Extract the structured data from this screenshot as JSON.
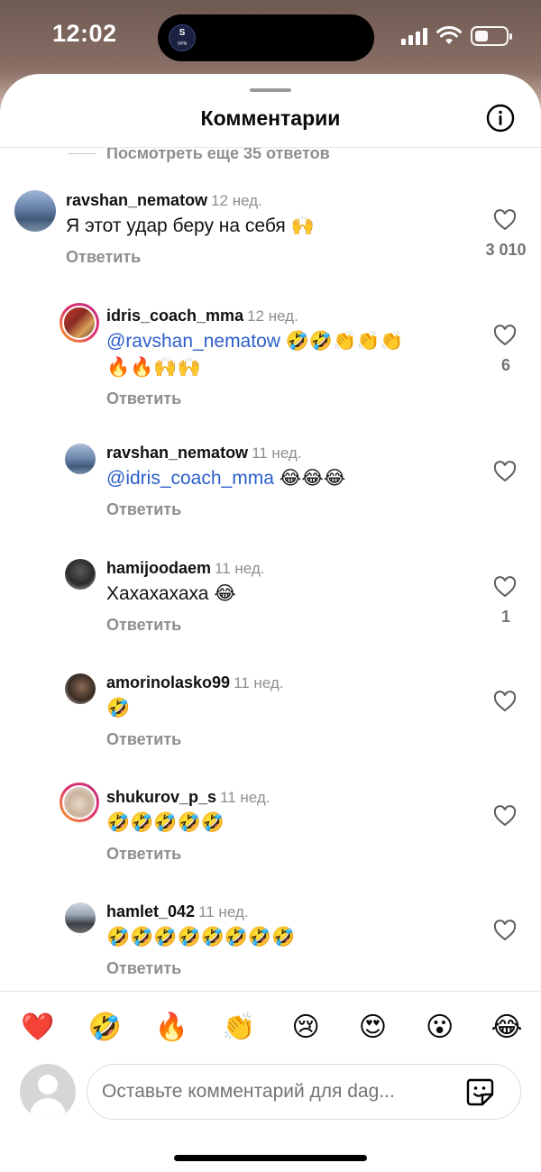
{
  "status_bar": {
    "time": "12:02",
    "vpn_label": "S",
    "vpn_sub": "VPN"
  },
  "sheet": {
    "title": "Комментарии",
    "more_replies": "Посмотреть еще 35 ответов"
  },
  "comments": [
    {
      "username": "ravshan_nematow",
      "time": "12 нед.",
      "text": "Я этот удар беру на себя 🙌",
      "reply": "Ответить",
      "likes": "3 010"
    },
    {
      "username": "idris_coach_mma",
      "time": "12 нед.",
      "mention": "@ravshan_nematow",
      "text": " 🤣🤣👏👏👏",
      "text2": "🔥🔥🙌🙌",
      "reply": "Ответить",
      "likes": "6"
    },
    {
      "username": "ravshan_nematow",
      "time": "11 нед.",
      "mention": "@idris_coach_mma",
      "text": " 😂😂😂",
      "reply": "Ответить",
      "likes": ""
    },
    {
      "username": "hamijoodaem",
      "time": "11 нед.",
      "text": "Хахахахаха 😂",
      "reply": "Ответить",
      "likes": "1"
    },
    {
      "username": "amorinolasko99",
      "time": "11 нед.",
      "text": "🤣",
      "reply": "Ответить",
      "likes": ""
    },
    {
      "username": "shukurov_p_s",
      "time": "11 нед.",
      "text": "🤣🤣🤣🤣🤣",
      "reply": "Ответить",
      "likes": ""
    },
    {
      "username": "hamlet_042",
      "time": "11 нед.",
      "text": "🤣🤣🤣🤣🤣🤣🤣🤣",
      "reply": "Ответить",
      "likes": ""
    }
  ],
  "reactions": [
    "❤️",
    "🤣",
    "🔥",
    "👏",
    "😢",
    "😍",
    "😮",
    "😂"
  ],
  "composer": {
    "placeholder": "Оставьте комментарий для dag..."
  },
  "icons": {
    "info": "info-icon",
    "like": "heart-outline-icon",
    "sticker": "sticker-icon",
    "wifi": "wifi-icon",
    "battery": "battery-icon",
    "signal": "signal-icon"
  }
}
